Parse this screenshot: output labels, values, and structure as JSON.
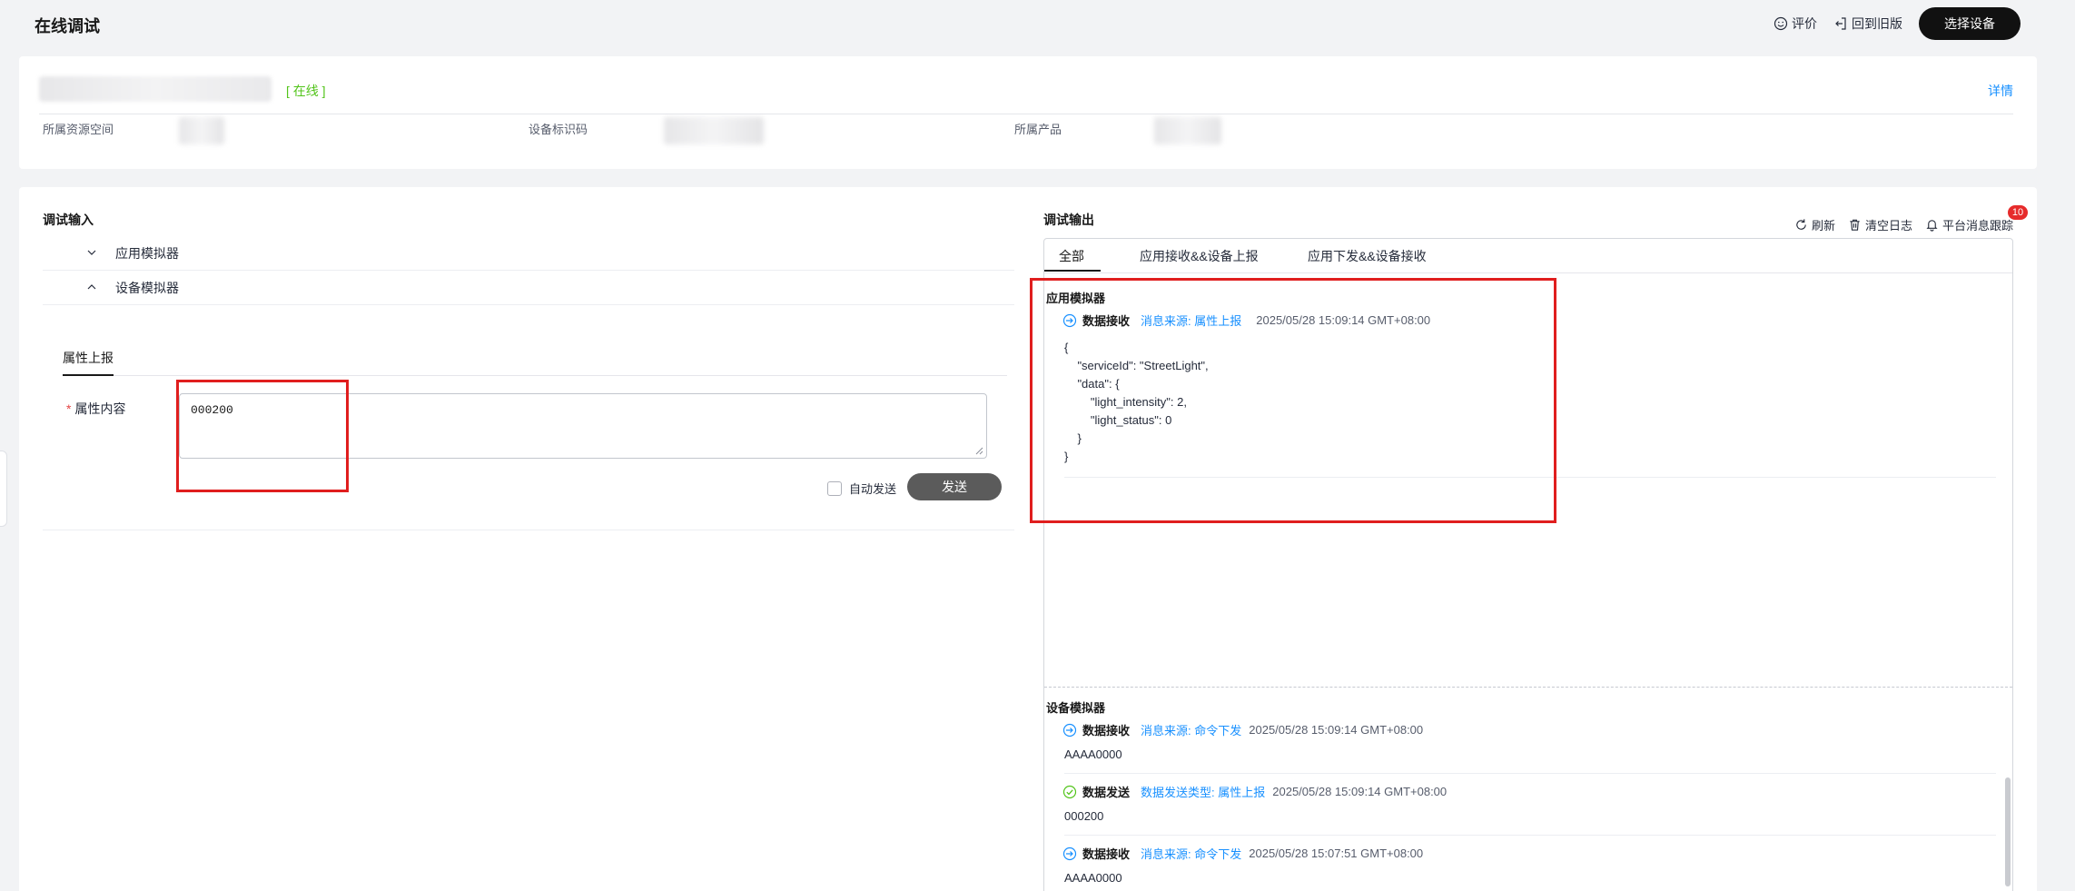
{
  "header": {
    "title": "在线调试",
    "rate_label": "评价",
    "back_label": "回到旧版",
    "select_device_label": "选择设备"
  },
  "device": {
    "status": "[ 在线 ]",
    "detail_label": "详情",
    "fields": {
      "resource_space_label": "所属资源空间",
      "device_id_label": "设备标识码",
      "product_label": "所属产品"
    }
  },
  "input": {
    "title": "调试输入",
    "app_simulator_label": "应用模拟器",
    "device_simulator_label": "设备模拟器",
    "tab_label": "属性上报",
    "property_label": "属性内容",
    "property_value": "000200",
    "auto_send_label": "自动发送",
    "send_label": "发送"
  },
  "output": {
    "title": "调试输出",
    "tools": {
      "refresh_label": "刷新",
      "clear_label": "清空日志",
      "trace_label": "平台消息跟踪",
      "trace_badge": "10"
    },
    "tabs": [
      "全部",
      "应用接收&&设备上报",
      "应用下发&&设备接收"
    ],
    "app_section": {
      "title": "应用模拟器",
      "message": {
        "kind": "数据接收",
        "source": "消息来源: 属性上报",
        "time": "2025/05/28 15:09:14 GMT+08:00",
        "body": "{\n    \"serviceId\": \"StreetLight\",\n    \"data\": {\n        \"light_intensity\": 2,\n        \"light_status\": 0\n    }\n}"
      }
    },
    "device_section": {
      "title": "设备模拟器",
      "messages": [
        {
          "kind": "数据接收",
          "source": "消息来源: 命令下发",
          "time": "2025/05/28 15:09:14 GMT+08:00",
          "body": "AAAA0000"
        },
        {
          "kind": "数据发送",
          "source": "数据发送类型: 属性上报",
          "time": "2025/05/28 15:09:14 GMT+08:00",
          "body": "000200"
        },
        {
          "kind": "数据接收",
          "source": "消息来源: 命令下发",
          "time": "2025/05/28 15:07:51 GMT+08:00",
          "body": "AAAA0000"
        }
      ]
    }
  },
  "colors": {
    "accent": "#1890ff",
    "online": "#52c41a",
    "highlight": "#e01e1e",
    "badge": "#e62b2b"
  }
}
